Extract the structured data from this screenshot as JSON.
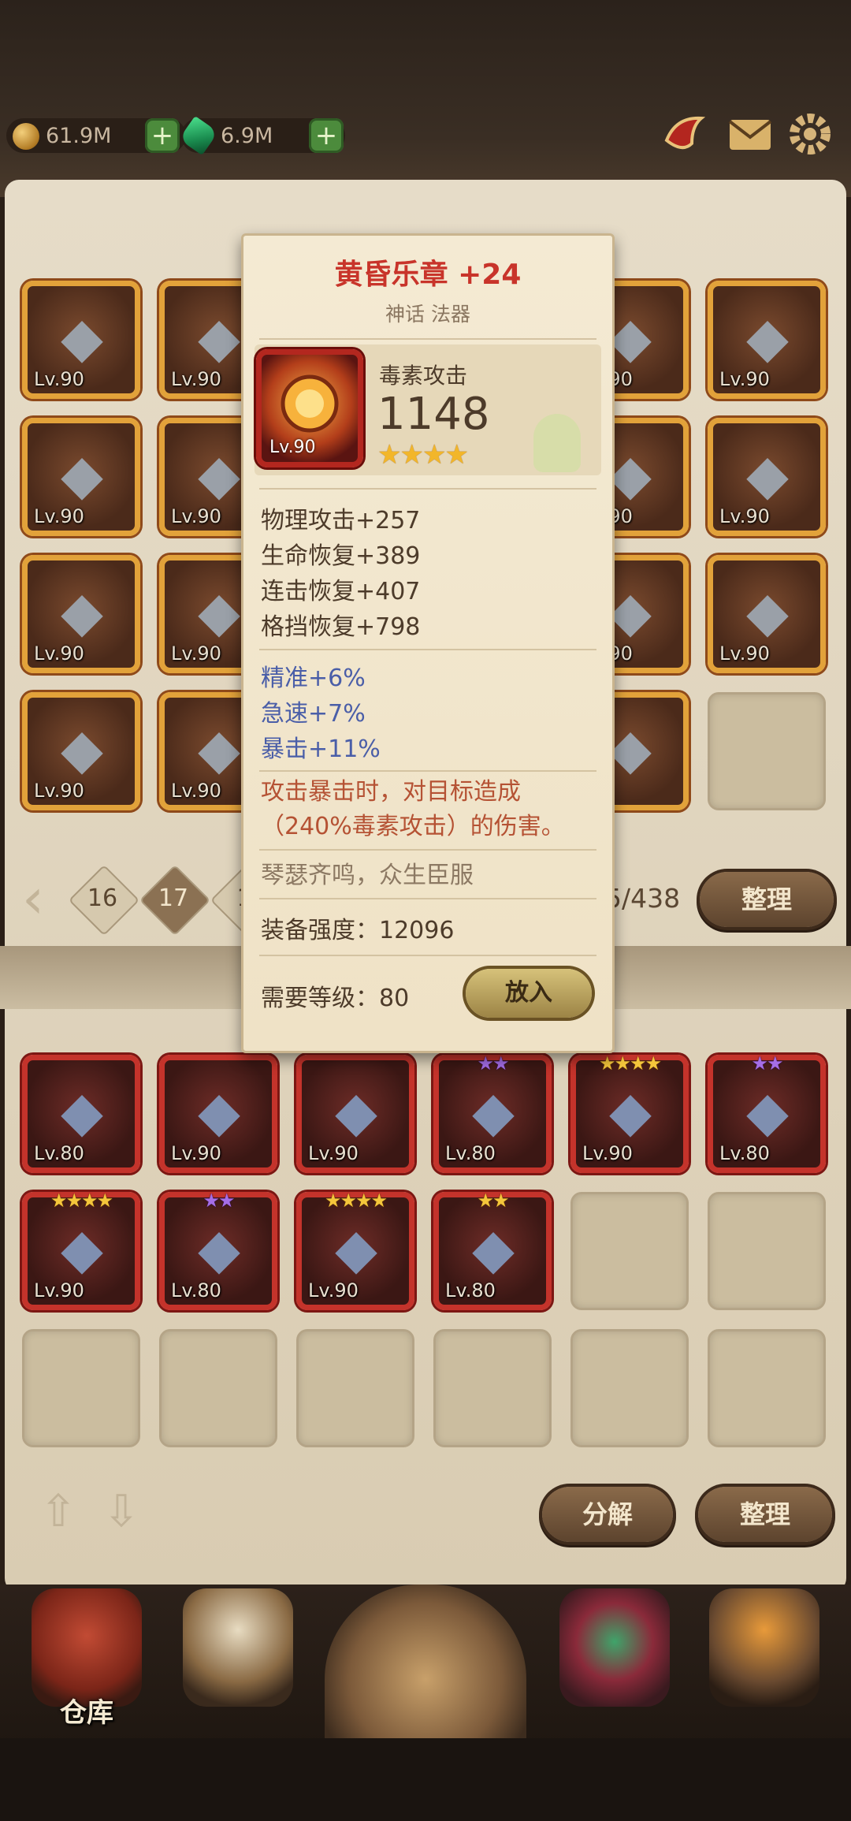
{
  "resources": [
    {
      "label": "61.9M",
      "icon": "coin-icon",
      "plus": "+"
    },
    {
      "label": "6.9M",
      "icon": "gem-icon",
      "plus": "+"
    }
  ],
  "top_icons": [
    "horn-icon",
    "mail-icon",
    "gear-icon"
  ],
  "inventory_slots": [
    {
      "lv": "Lv.90",
      "icon": "claw-icon",
      "frame": "gold"
    },
    {
      "lv": "Lv.90",
      "icon": "blade-icon",
      "frame": "gold"
    },
    {
      "lv": "Lv.90",
      "icon": "helmet-icon",
      "frame": "gold"
    },
    {
      "lv": "Lv.90",
      "icon": "mask-icon",
      "frame": "gold"
    },
    {
      "lv": "Lv.90",
      "icon": "eye-ring-icon",
      "frame": "gold"
    },
    {
      "lv": "Lv.90",
      "icon": "cloak-icon",
      "frame": "gold"
    },
    {
      "lv": "Lv.90",
      "icon": "spiked-ring-icon",
      "frame": "gold"
    },
    {
      "lv": "Lv.90",
      "icon": "jade-ring-icon",
      "frame": "gold"
    },
    {
      "lv": "Lv.90",
      "icon": "ring-icon",
      "frame": "gold"
    },
    {
      "lv": "Lv.90",
      "icon": "horn-charm-icon",
      "frame": "gold"
    },
    {
      "lv": "Lv.90",
      "icon": "dagger-icon",
      "frame": "gold"
    },
    {
      "lv": "Lv.90",
      "icon": "crystal-blade-icon",
      "frame": "gold"
    },
    {
      "lv": "Lv.90",
      "icon": "boot-icon",
      "frame": "gold"
    },
    {
      "lv": "Lv.90",
      "icon": "helm-icon",
      "frame": "gold"
    },
    {
      "lv": "90",
      "icon": "bracelet-icon",
      "frame": "gold"
    }
  ],
  "pager": {
    "pages": [
      "16",
      "17",
      "1"
    ],
    "count": "5/438",
    "sort_label": "整理"
  },
  "equipped_slots": [
    {
      "lv": "Lv.80",
      "icon": "boot-icon",
      "stars": "",
      "stars_color": "gold"
    },
    {
      "lv": "Lv.90",
      "icon": "eyeball-icon",
      "stars": "",
      "stars_color": "gold"
    },
    {
      "lv": "Lv.90",
      "icon": "scimitar-icon",
      "stars": "",
      "stars_color": "gold"
    },
    {
      "lv": "Lv.80",
      "icon": "red-blade-icon",
      "stars": "★★",
      "stars_color": "purple"
    },
    {
      "lv": "Lv.90",
      "icon": "amber-orb-icon",
      "stars": "★★★★",
      "stars_color": "gold"
    },
    {
      "lv": "Lv.80",
      "icon": "swirl-glove-icon",
      "stars": "★★",
      "stars_color": "purple"
    },
    {
      "lv": "Lv.90",
      "icon": "armor-icon",
      "stars": "★★★★",
      "stars_color": "gold"
    },
    {
      "lv": "Lv.80",
      "icon": "eyeball-icon",
      "stars": "★★",
      "stars_color": "purple"
    },
    {
      "lv": "Lv.90",
      "icon": "wing-icon",
      "stars": "★★★★",
      "stars_color": "gold"
    },
    {
      "lv": "Lv.80",
      "icon": "amulet-icon",
      "stars": "★★",
      "stars_color": "gold"
    }
  ],
  "bottom_buttons": {
    "decompose": "分解",
    "sort": "整理"
  },
  "nav": [
    {
      "label": "仓库",
      "icon": "warehouse-icon"
    },
    {
      "label": "",
      "icon": "tavern-icon"
    },
    {
      "label": "",
      "icon": "adventure-icon"
    },
    {
      "label": "",
      "icon": "helmet-nav-icon"
    },
    {
      "label": "",
      "icon": "forge-icon"
    }
  ],
  "tooltip": {
    "title": "黄昏乐章 +24",
    "subtitle": "神话 法器",
    "item_lv": "Lv.90",
    "main_attr_label": "毒素攻击",
    "main_attr_value": "1148",
    "stars": "★★★★",
    "stats": [
      "物理攻击+257",
      "生命恢复+389",
      "连击恢复+407",
      "格挡恢复+798"
    ],
    "bonus": [
      "精准+6%",
      "急速+7%",
      "暴击+11%"
    ],
    "effect": "攻击暴击时，对目标造成（240%毒素攻击）的伤害。",
    "flavor": "琴瑟齐鸣，众生臣服",
    "power_label": "装备强度：",
    "power_value": "12096",
    "level_label": "需要等级：",
    "level_value": "80",
    "action": "放入"
  }
}
